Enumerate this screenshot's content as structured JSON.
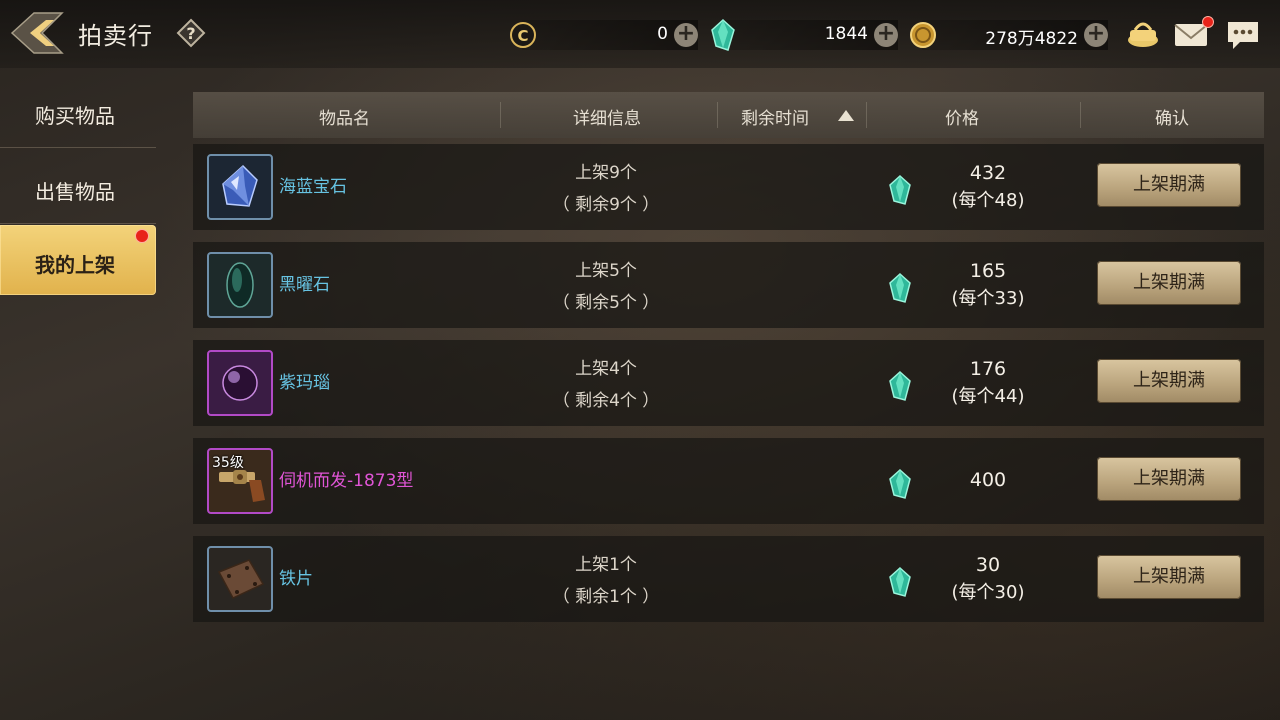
{
  "header": {
    "title": "拍卖行",
    "currencies": [
      {
        "icon": "coupon-icon",
        "value": "0"
      },
      {
        "icon": "green-gem-icon",
        "value": "1844"
      },
      {
        "icon": "gold-coin-icon",
        "value": "278万4822"
      }
    ],
    "icons": [
      "cart-icon",
      "mail-icon",
      "chat-icon"
    ]
  },
  "sidebar": {
    "items": [
      {
        "label": "购买物品",
        "active": false
      },
      {
        "label": "出售物品",
        "active": false
      },
      {
        "label": "我的上架",
        "active": true
      }
    ]
  },
  "table": {
    "columns": [
      "物品名",
      "详细信息",
      "剩余时间",
      "价格",
      "确认"
    ],
    "rows": [
      {
        "name": "海蓝宝石",
        "icon": "aquamarine-icon",
        "detail1": "上架9个",
        "detail2": "（ 剩余9个 ）",
        "price": "432",
        "unit": "(每个48)",
        "button": "上架期满"
      },
      {
        "name": "黑曜石",
        "icon": "obsidian-icon",
        "detail1": "上架5个",
        "detail2": "（ 剩余5个 ）",
        "price": "165",
        "unit": "(每个33)",
        "button": "上架期满"
      },
      {
        "name": "紫玛瑙",
        "icon": "purple-agate-icon",
        "detail1": "上架4个",
        "detail2": "（ 剩余4个 ）",
        "price": "176",
        "unit": "(每个44)",
        "button": "上架期满"
      },
      {
        "name": "伺机而发-1873型",
        "icon": "revolver-icon",
        "level": "35级",
        "price": "400",
        "button": "上架期满"
      },
      {
        "name": "铁片",
        "icon": "iron-plate-icon",
        "detail1": "上架1个",
        "detail2": "（ 剩余1个 ）",
        "price": "30",
        "unit": "(每个30)",
        "button": "上架期满"
      }
    ]
  },
  "colors": {
    "accent": "#e1b24c",
    "item_blue": "#67c3e2",
    "item_purple": "#e055d6",
    "alert": "#e8231a"
  }
}
